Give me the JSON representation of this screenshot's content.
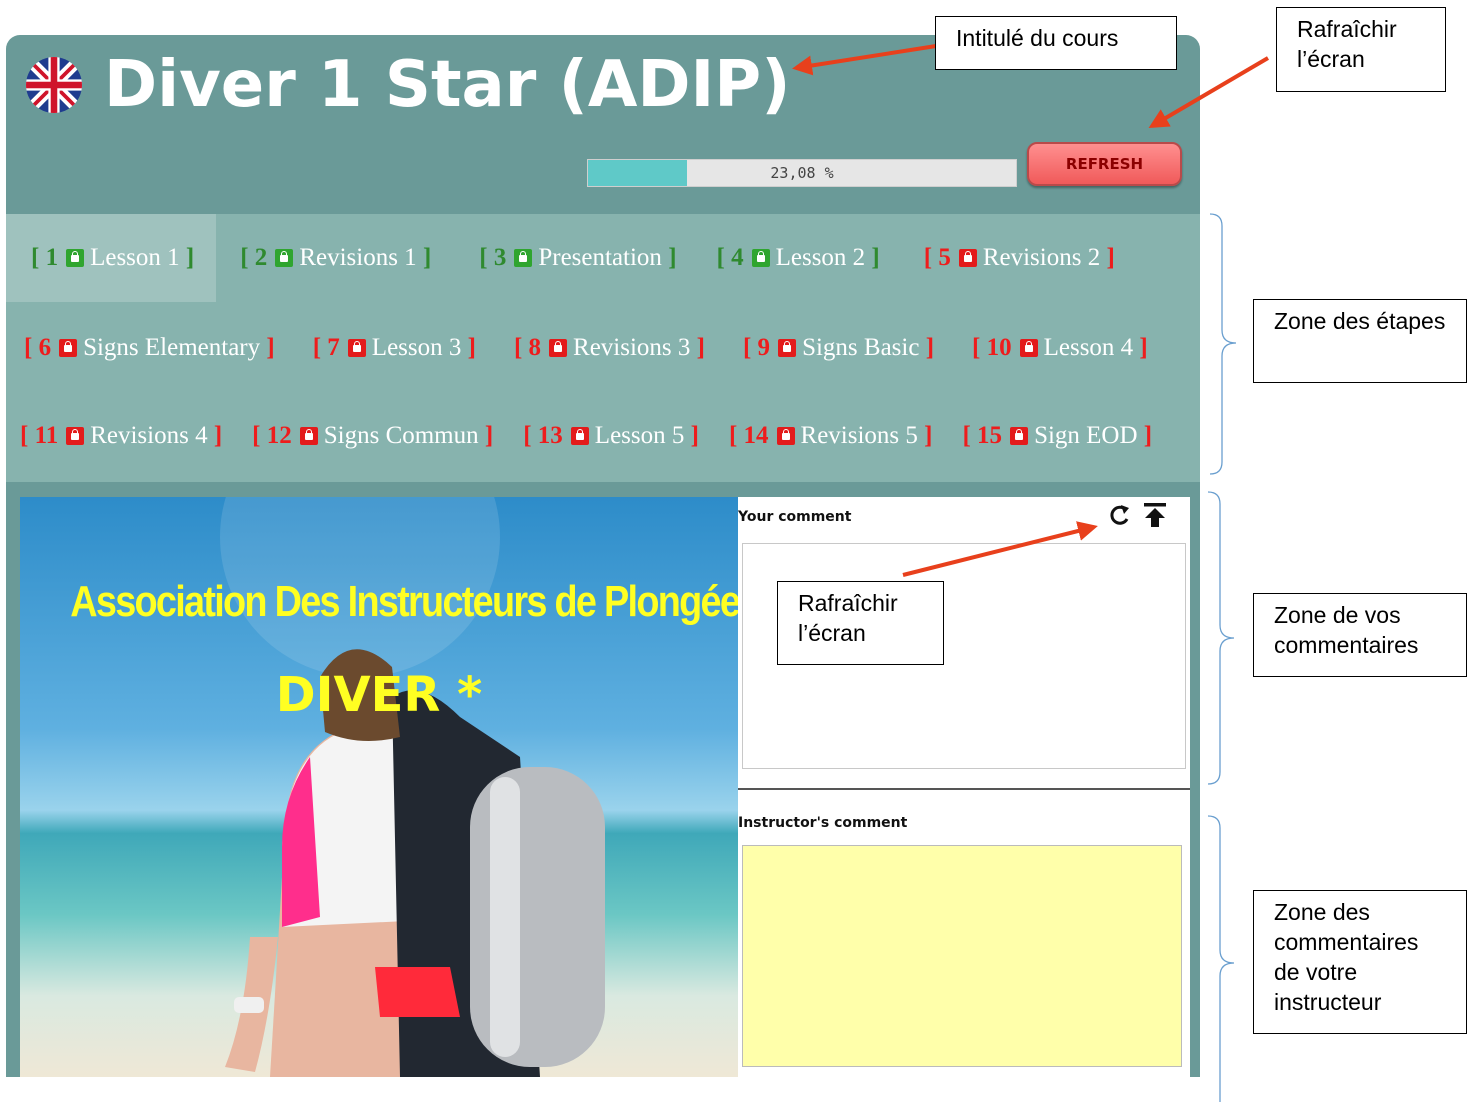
{
  "header": {
    "course_title": "Diver 1 Star (ADIP)",
    "flag_icon": "uk-flag-icon",
    "progress": {
      "percent": 23.08,
      "label": "23,08 %"
    },
    "refresh_label": "REFRESH"
  },
  "steps": [
    [
      {
        "num": "[ 1",
        "label": "Lesson 1 ]",
        "state": "green",
        "active": true
      },
      {
        "num": "[ 2",
        "label": "Revisions 1 ]",
        "state": "green"
      },
      {
        "num": "[ 3",
        "label": "Presentation ]",
        "state": "green"
      },
      {
        "num": "[ 4",
        "label": "Lesson 2 ]",
        "state": "green"
      },
      {
        "num": "[ 5",
        "label": "Revisions 2 ]",
        "state": "red"
      }
    ],
    [
      {
        "num": "[ 6",
        "label": "Signs Elementary ]",
        "state": "red"
      },
      {
        "num": "[ 7",
        "label": "Lesson 3 ]",
        "state": "red"
      },
      {
        "num": "[ 8",
        "label": "Revisions 3 ]",
        "state": "red"
      },
      {
        "num": "[ 9",
        "label": "Signs Basic ]",
        "state": "red"
      },
      {
        "num": "[ 10",
        "label": "Lesson 4 ]",
        "state": "red"
      }
    ],
    [
      {
        "num": "[ 11",
        "label": "Revisions 4 ]",
        "state": "red"
      },
      {
        "num": "[ 12",
        "label": "Signs Commun ]",
        "state": "red"
      },
      {
        "num": "[ 13",
        "label": "Lesson 5 ]",
        "state": "red"
      },
      {
        "num": "[ 14",
        "label": "Revisions 5 ]",
        "state": "red"
      },
      {
        "num": "[ 15",
        "label": "Sign EOD ]",
        "state": "red"
      }
    ]
  ],
  "content": {
    "image_title": "Association Des Instructeurs de Plongée",
    "image_subtitle": "DIVER *"
  },
  "comments": {
    "your_label": "Your comment",
    "your_value": "",
    "instructor_label": "Instructor's comment",
    "refresh_icon": "refresh-icon",
    "upload_icon": "upload-icon"
  },
  "annotations": {
    "course_title": "Intitulé du cours",
    "refresh_screen_top": "Rafraîchir l’écran",
    "refresh_screen_comment": "Rafraîchir l’écran",
    "steps_zone": "Zone des étapes",
    "your_comments_zone": "Zone de vos commentaires",
    "instructor_zone": "Zone des commentaires de votre instructeur"
  },
  "colors": {
    "panel": "#6a9a98",
    "steps_band": "#87b3ae",
    "step_done": "#2f8a2f",
    "step_locked": "#ee1c1c",
    "progress_fill": "#5fc9c8",
    "refresh_button": "#f05a5a",
    "instructor_box": "#ffffaa",
    "annotation_arrow": "#e8401c",
    "annotation_bracket": "#6a9fcf"
  }
}
